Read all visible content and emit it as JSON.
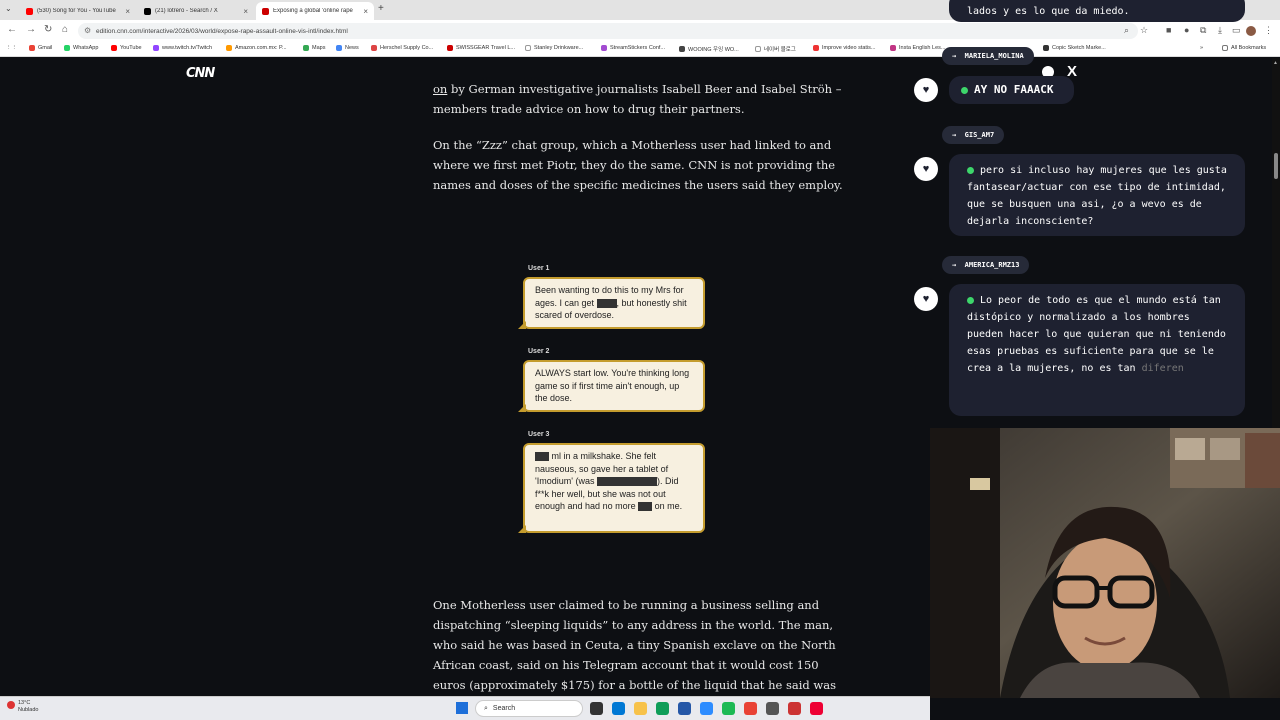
{
  "browser": {
    "tabs": [
      {
        "title": "(530) Song for You - YouTube",
        "color": "#ff0000"
      },
      {
        "title": "(21) lotrero - Search / X",
        "color": "#000000"
      },
      {
        "title": "Exposing a global 'online rape",
        "color": "#cc0000"
      }
    ],
    "url": "edition.cnn.com/interactive/2026/03/world/expose-rape-assault-online-vis-intl/index.html",
    "bookmarks": [
      "Gmail",
      "WhatsApp",
      "YouTube",
      "www.twitch.tv/Twitch",
      "Amazon.com.mx: P...",
      "Maps",
      "News",
      "Herschel Supply Co...",
      "SWISSGEAR Travel L...",
      "Stanley Drinkware...",
      "StreamStickers Conf...",
      "WOOING 우잉 WO...",
      "네이버 블로그",
      "Improve video statis...",
      "Insta English Les...",
      "Copic Sketch Marke..."
    ],
    "all_bookmarks": "All Bookmarks"
  },
  "article": {
    "logo": "CNN",
    "para1_link": "on",
    "para1": " by German investigative journalists Isabell Beer and Isabel Ströh – members trade advice on how to drug their partners.",
    "para2": "On the “Zzz” chat group, which a Motherless user had linked to and where we first met Piotr, they do the same. CNN is not providing the names and doses of the specific medicines the users said they employ.",
    "para3": "One Motherless user claimed to be running a business selling and dispatching “sleeping liquids” to any address in the world. The man, who said he was based in Ceuta, a tiny Spanish exclave on the North African coast, said on his Telegram account that it would cost 150 euros (approximately $175) for a bottle of the liquid that he said was tasteless and",
    "chat": [
      {
        "user": "User 1",
        "parts": [
          "Been wanting to do this to my Mrs for ages. I can get ",
          ", but honestly shit scared of overdose."
        ]
      },
      {
        "user": "User 2",
        "text": "ALWAYS start low. You're thinking long game so if first time ain't enough, up the dose."
      },
      {
        "user": "User 3",
        "parts": [
          " ml in a milkshake. She felt nauseous, so gave her a tablet of 'Imodium' (was ",
          "). Did f**k her well, but she was not out enough and had no more ",
          " on me."
        ]
      }
    ]
  },
  "overlay": {
    "top_msg": "lados y es lo que da miedo.",
    "messages": [
      {
        "user": "MARIELA_MOLINA",
        "text": "AY NO FAAACK"
      },
      {
        "user": "GIS_AM7",
        "text": "pero si incluso hay mujeres que les gusta fantasear/actuar con ese tipo de intimidad, que se busquen una asi, ¿o a wevo es de dejarla inconsciente?"
      },
      {
        "user": "AMERICA_RMZ13",
        "text": "Lo peor de todo es que el mundo está tan distópico y normalizado a los hombres pueden hacer lo que quieran que ni teniendo esas pruebas es suficiente para que se le crea a la mujeres, no es tan",
        "fade": "diferen"
      }
    ]
  },
  "taskbar": {
    "temp": "13°C",
    "weather": "Nublado",
    "search": "Search"
  }
}
